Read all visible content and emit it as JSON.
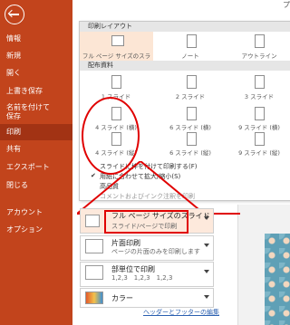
{
  "sidebar": {
    "items": [
      {
        "label": "情報"
      },
      {
        "label": "新規"
      },
      {
        "label": "開く"
      },
      {
        "label": "上書き保存"
      },
      {
        "label": "名前を付けて"
      },
      {
        "label": "保存"
      },
      {
        "label": "印刷"
      },
      {
        "label": "共有"
      },
      {
        "label": "エクスポート"
      },
      {
        "label": "閉じる"
      },
      {
        "label": "アカウント"
      },
      {
        "label": "オプション"
      }
    ]
  },
  "header": {
    "right_text": "プ"
  },
  "dropdown": {
    "print_layout_title": "印刷レイアウト",
    "layouts": [
      {
        "label": "フル ページ サイズのスライド"
      },
      {
        "label": "ノート"
      },
      {
        "label": "アウトライン"
      }
    ],
    "handouts_title": "配布資料",
    "handouts": [
      {
        "label": "1 スライド"
      },
      {
        "label": "2 スライド"
      },
      {
        "label": "3 スライド"
      },
      {
        "label": "4 スライド (横)"
      },
      {
        "label": "6 スライド (横)"
      },
      {
        "label": "9 スライド (横)"
      },
      {
        "label": "4 スライド (縦)"
      },
      {
        "label": "6 スライド (縦)"
      },
      {
        "label": "9 スライド (縦)"
      }
    ],
    "options": [
      {
        "label": "スライドに枠を付けて印刷する(F)"
      },
      {
        "label": "用紙に合わせて拡大/縮小(S)"
      },
      {
        "label": "高品質"
      },
      {
        "label": "コメントおよびインク注釈を印刷"
      }
    ]
  },
  "settings": {
    "layout_main": "フル ページ サイズのスライド",
    "layout_sub": "スライド/ページで印刷",
    "sides_main": "片面印刷",
    "sides_sub": "ページの片面のみを印刷します",
    "collate_main": "部単位で印刷",
    "collate_sub": "1,2,3　1,2,3　1,2,3",
    "color_main": "カラー"
  },
  "footer": {
    "link": "ヘッダーとフッターの編集"
  }
}
